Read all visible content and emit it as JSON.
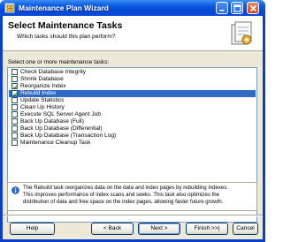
{
  "window": {
    "title": "Maintenance Plan Wizard"
  },
  "header": {
    "title": "Select Maintenance Tasks",
    "subtitle": "Which tasks should this plan perform?"
  },
  "list": {
    "label": "Select one or more maintenance tasks:",
    "items": [
      {
        "label": "Check Database Integrity",
        "checked": false,
        "selected": false
      },
      {
        "label": "Shrink Database",
        "checked": false,
        "selected": false
      },
      {
        "label": "Reorganize Index",
        "checked": true,
        "selected": false
      },
      {
        "label": "Rebuild Index",
        "checked": true,
        "selected": true
      },
      {
        "label": "Update Statistics",
        "checked": false,
        "selected": false
      },
      {
        "label": "Clean Up History",
        "checked": false,
        "selected": false
      },
      {
        "label": "Execute SQL Server Agent Job",
        "checked": false,
        "selected": false
      },
      {
        "label": "Back Up Database (Full)",
        "checked": false,
        "selected": false
      },
      {
        "label": "Back Up Database (Differential)",
        "checked": false,
        "selected": false
      },
      {
        "label": "Back Up Database (Transaction Log)",
        "checked": false,
        "selected": false
      },
      {
        "label": "Maintenance Cleanup Task",
        "checked": false,
        "selected": false
      }
    ]
  },
  "info": {
    "line1": "The Rebuild task reorganizes data on the data and index pages by rebuilding indexes.",
    "line2": "This improves performance of index scans and seeks. This task also optimizes the",
    "line3": "distribution of data and free space on the index pages, allowing faster future growth."
  },
  "buttons": {
    "help": "Help",
    "back": "< Back",
    "next": "Next >",
    "finish": "Finish >>|",
    "cancel": "Cancel"
  },
  "colors": {
    "selection": "#316ac5",
    "titlebar": "#0b5ce0",
    "dialog": "#ece9d8"
  }
}
